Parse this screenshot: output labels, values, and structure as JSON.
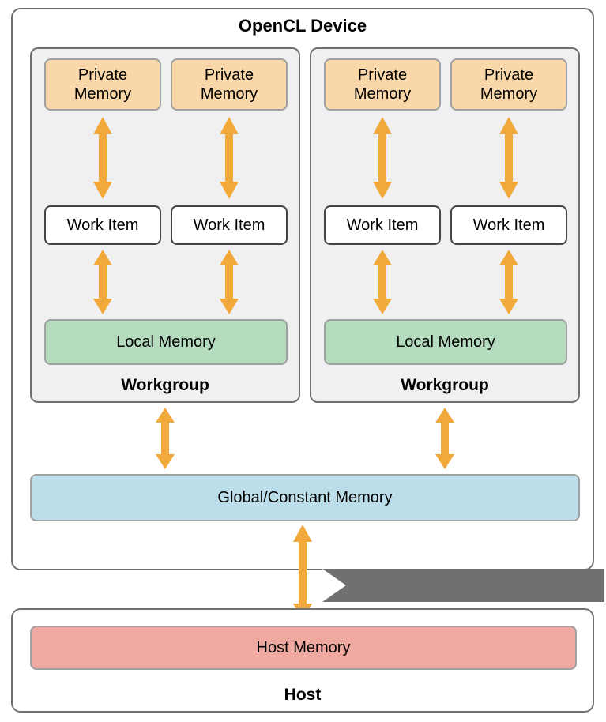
{
  "device": {
    "title": "OpenCL Device",
    "global_memory": "Global/Constant Memory",
    "workgroups": [
      {
        "label": "Workgroup",
        "private_memory": "Private Memory",
        "work_item": "Work Item",
        "local_memory": "Local Memory"
      },
      {
        "label": "Workgroup",
        "private_memory": "Private Memory",
        "work_item": "Work Item",
        "local_memory": "Local Memory"
      }
    ]
  },
  "host": {
    "label": "Host",
    "memory": "Host Memory"
  },
  "colors": {
    "private_memory": "#f9d7a8",
    "work_item": "#ffffff",
    "local_memory": "#b4dbbd",
    "global_memory": "#bcddea",
    "host_memory": "#efa9a0",
    "arrow": "#f2a93c",
    "workgroup_bg": "#f0f0f0",
    "border": "#707070"
  }
}
